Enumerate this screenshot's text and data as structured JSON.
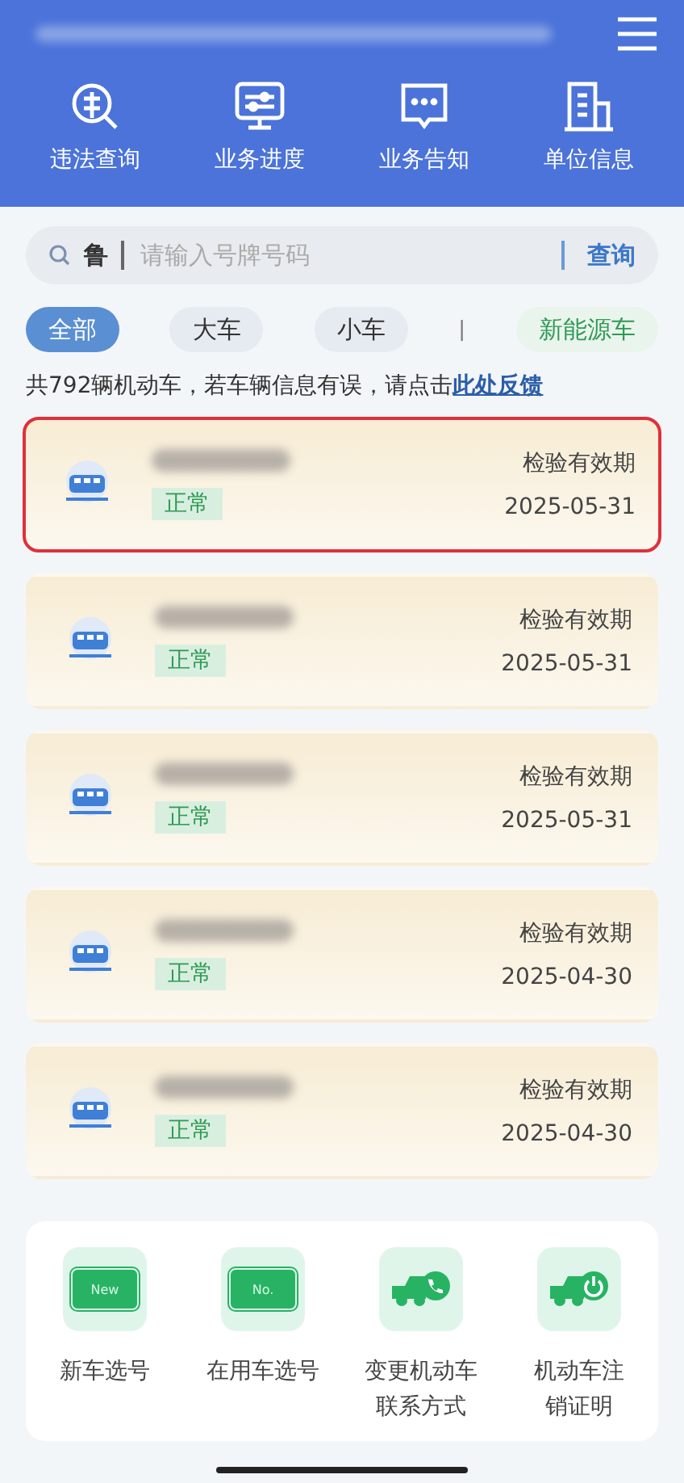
{
  "nav": [
    {
      "label": "违法查询",
      "kind": "violation"
    },
    {
      "label": "业务进度",
      "kind": "monitor"
    },
    {
      "label": "业务告知",
      "kind": "message"
    },
    {
      "label": "单位信息",
      "kind": "building"
    }
  ],
  "search": {
    "province": "鲁",
    "placeholder": "请输入号牌号码",
    "button": "查询"
  },
  "filters": [
    {
      "label": "全部",
      "kind": "chip",
      "selected": true
    },
    {
      "label": "大车",
      "kind": "chip",
      "selected": false
    },
    {
      "label": "小车",
      "kind": "chip",
      "selected": false
    },
    {
      "label": "|",
      "kind": "divider",
      "selected": false
    },
    {
      "label": "新能源车",
      "kind": "energy",
      "selected": false
    }
  ],
  "summary": {
    "text": "共792辆机动车，若车辆信息有误，请点击",
    "link": "此处反馈"
  },
  "vehicles": [
    {
      "status": "正常",
      "expiry_label": "检验有效期",
      "expiry": "2025-05-31",
      "selected": true
    },
    {
      "status": "正常",
      "expiry_label": "检验有效期",
      "expiry": "2025-05-31",
      "selected": false
    },
    {
      "status": "正常",
      "expiry_label": "检验有效期",
      "expiry": "2025-05-31",
      "selected": false
    },
    {
      "status": "正常",
      "expiry_label": "检验有效期",
      "expiry": "2025-04-30",
      "selected": false
    },
    {
      "status": "正常",
      "expiry_label": "检验有效期",
      "expiry": "2025-04-30",
      "selected": false
    }
  ],
  "services": [
    {
      "label": [
        "新车选号"
      ],
      "kind": "plate",
      "plate_text": "New"
    },
    {
      "label": [
        "在用车选号"
      ],
      "kind": "plate",
      "plate_text": "No."
    },
    {
      "label": [
        "变更机动车",
        "联系方式"
      ],
      "kind": "truck-phone"
    },
    {
      "label": [
        "机动车注",
        "销证明"
      ],
      "kind": "truck-power"
    }
  ]
}
